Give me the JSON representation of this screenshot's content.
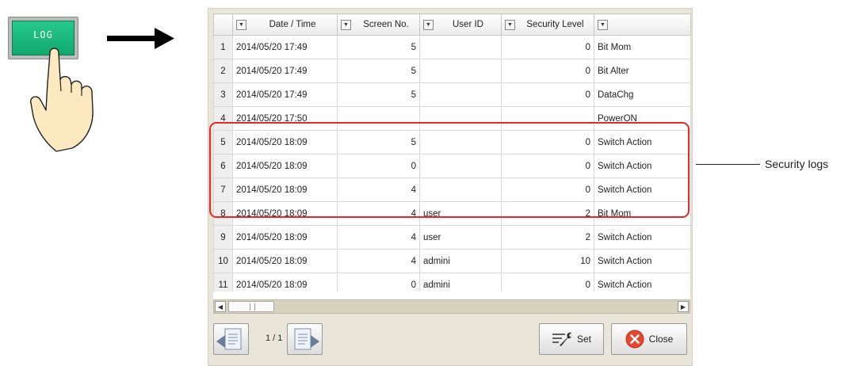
{
  "log_button": {
    "label": "LOG"
  },
  "table": {
    "columns": [
      "",
      "Date / Time",
      "Screen No.",
      "User ID",
      "Security Level",
      ""
    ],
    "rows": [
      {
        "no": "1",
        "datetime": "2014/05/20 17:49",
        "screen": "5",
        "user": "",
        "level": "0",
        "action": "Bit Mom"
      },
      {
        "no": "2",
        "datetime": "2014/05/20 17:49",
        "screen": "5",
        "user": "",
        "level": "0",
        "action": "Bit Alter"
      },
      {
        "no": "3",
        "datetime": "2014/05/20 17:49",
        "screen": "5",
        "user": "",
        "level": "0",
        "action": "DataChg"
      },
      {
        "no": "4",
        "datetime": "2014/05/20 17:50",
        "screen": "",
        "user": "",
        "level": "",
        "action": "PowerON"
      },
      {
        "no": "5",
        "datetime": "2014/05/20 18:09",
        "screen": "5",
        "user": "",
        "level": "0",
        "action": "Switch Action"
      },
      {
        "no": "6",
        "datetime": "2014/05/20 18:09",
        "screen": "0",
        "user": "",
        "level": "0",
        "action": "Switch Action"
      },
      {
        "no": "7",
        "datetime": "2014/05/20 18:09",
        "screen": "4",
        "user": "",
        "level": "0",
        "action": "Switch Action"
      },
      {
        "no": "8",
        "datetime": "2014/05/20 18:09",
        "screen": "4",
        "user": "user",
        "level": "2",
        "action": "Bit Mom"
      },
      {
        "no": "9",
        "datetime": "2014/05/20 18:09",
        "screen": "4",
        "user": "user",
        "level": "2",
        "action": "Switch Action"
      },
      {
        "no": "10",
        "datetime": "2014/05/20 18:09",
        "screen": "4",
        "user": "admini",
        "level": "10",
        "action": "Switch Action"
      },
      {
        "no": "11",
        "datetime": "2014/05/20 18:09",
        "screen": "0",
        "user": "admini",
        "level": "0",
        "action": "Switch Action"
      }
    ]
  },
  "pagination": {
    "indicator": "1 / 1"
  },
  "buttons": {
    "set": "Set",
    "close": "Close"
  },
  "callout": {
    "label": "Security logs"
  },
  "colors": {
    "log_button": "#1fb87e",
    "highlight": "#e52a26",
    "close_icon": "#e8462f"
  },
  "icons": [
    "pointing-hand-icon",
    "arrow-right-icon",
    "dropdown-arrow-icon",
    "page-prev-icon",
    "page-next-icon",
    "wrench-icon",
    "close-x-icon"
  ]
}
